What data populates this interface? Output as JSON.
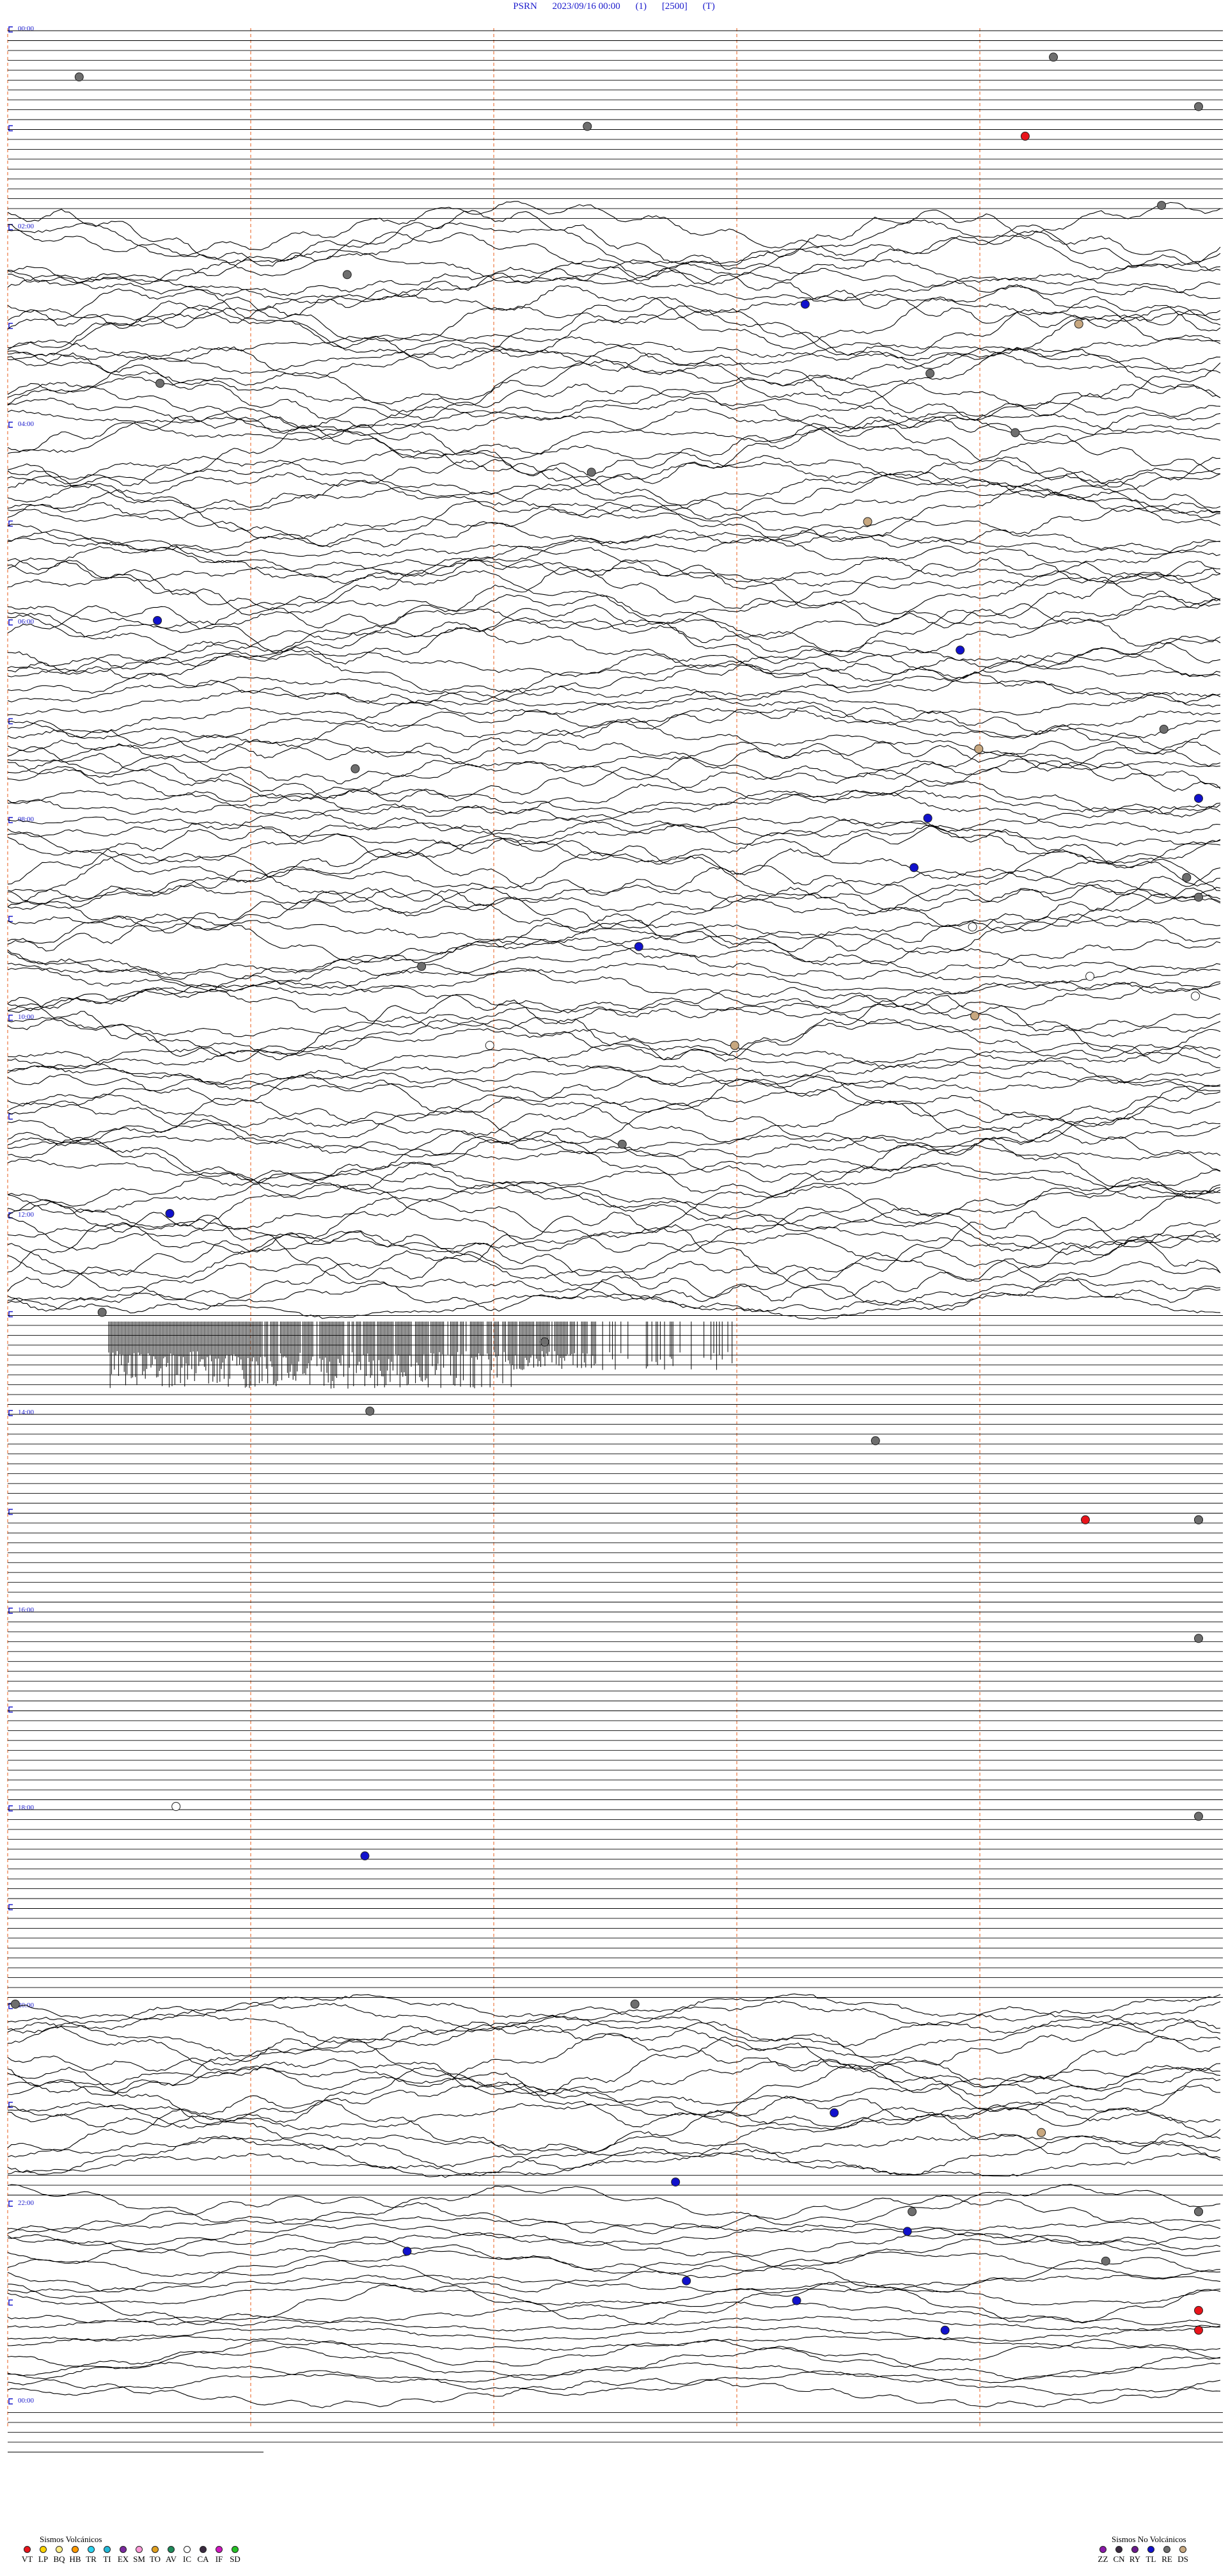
{
  "header": {
    "station": "PSRN",
    "datetime": "2023/09/16 00:00",
    "channel": "(1)",
    "scale": "[2500]",
    "unit": "(T)"
  },
  "chart_data": {
    "type": "line",
    "title": "PSRN 2023/09/16 00:00 (1) [2500] (T)",
    "time_labels": [
      "00:00",
      "02:00",
      "04:00",
      "06:00",
      "08:00",
      "10:00",
      "12:00",
      "14:00",
      "16:00",
      "18:00",
      "20:00",
      "22:00",
      "00:00"
    ],
    "rows_per_hour": 10,
    "minutes_per_row": 6,
    "vertical_marker_minutes": [
      0,
      1.2,
      2.4,
      3.6,
      4.8
    ],
    "active_periods": [
      {
        "from": "02:00",
        "to": "13:00",
        "amplitude": "high"
      },
      {
        "from": "20:00",
        "to": "21:40",
        "amplitude": "high"
      },
      {
        "from": "22:00",
        "to": "24:00",
        "amplitude": "medium"
      }
    ],
    "burst": {
      "row_hour": "13:00",
      "description": "dense spike train"
    },
    "events": [
      {
        "time": "00:22",
        "code": "RE"
      },
      {
        "time": "00:52",
        "code": "RE"
      },
      {
        "time": "00:30",
        "code": "RE"
      },
      {
        "time": "01:02",
        "code": "RE"
      },
      {
        "time": "01:06",
        "code": "VT"
      },
      {
        "time": "01:50",
        "code": "RE"
      },
      {
        "time": "02:30",
        "code": "RE"
      },
      {
        "time": "02:50",
        "code": "TL"
      },
      {
        "time": "03:00",
        "code": "DS"
      },
      {
        "time": "03:34",
        "code": "RE"
      },
      {
        "time": "03:36",
        "code": "RE"
      },
      {
        "time": "04:10",
        "code": "RE"
      },
      {
        "time": "04:30",
        "code": "RE"
      },
      {
        "time": "05:00",
        "code": "DS"
      },
      {
        "time": "06:00",
        "code": "TL"
      },
      {
        "time": "06:20",
        "code": "TL"
      },
      {
        "time": "07:10",
        "code": "RE"
      },
      {
        "time": "07:20",
        "code": "DS"
      },
      {
        "time": "07:50",
        "code": "TL"
      },
      {
        "time": "07:30",
        "code": "RE"
      },
      {
        "time": "08:00",
        "code": "TL"
      },
      {
        "time": "08:30",
        "code": "TL"
      },
      {
        "time": "08:40",
        "code": "RE"
      },
      {
        "time": "08:50",
        "code": "RE"
      },
      {
        "time": "09:10",
        "code": "IC"
      },
      {
        "time": "09:20",
        "code": "TL"
      },
      {
        "time": "09:30",
        "code": "RE"
      },
      {
        "time": "09:40",
        "code": "IC"
      },
      {
        "time": "09:50",
        "code": "IC"
      },
      {
        "time": "10:00",
        "code": "DS"
      },
      {
        "time": "10:20",
        "code": "IC"
      },
      {
        "time": "10:20",
        "code": "DS"
      },
      {
        "time": "11:20",
        "code": "RE"
      },
      {
        "time": "12:00",
        "code": "TL"
      },
      {
        "time": "13:00",
        "code": "RE"
      },
      {
        "time": "13:20",
        "code": "RE"
      },
      {
        "time": "14:00",
        "code": "RE"
      },
      {
        "time": "14:20",
        "code": "RE"
      },
      {
        "time": "15:10",
        "code": "VT"
      },
      {
        "time": "15:10",
        "code": "RE"
      },
      {
        "time": "15:10",
        "code": "RE"
      },
      {
        "time": "16:20",
        "code": "RE"
      },
      {
        "time": "18:00",
        "code": "IC"
      },
      {
        "time": "18:10",
        "code": "RE"
      },
      {
        "time": "18:30",
        "code": "TL"
      },
      {
        "time": "20:00",
        "code": "RE"
      },
      {
        "time": "20:00",
        "code": "RE"
      },
      {
        "time": "21:10",
        "code": "TL"
      },
      {
        "time": "21:20",
        "code": "DS"
      },
      {
        "time": "21:50",
        "code": "TL"
      },
      {
        "time": "22:10",
        "code": "RE"
      },
      {
        "time": "22:10",
        "code": "RE"
      },
      {
        "time": "22:10",
        "code": "RE"
      },
      {
        "time": "22:20",
        "code": "TL"
      },
      {
        "time": "22:30",
        "code": "TL"
      },
      {
        "time": "22:40",
        "code": "RE"
      },
      {
        "time": "22:50",
        "code": "TL"
      },
      {
        "time": "23:00",
        "code": "TL"
      },
      {
        "time": "23:10",
        "code": "VT"
      },
      {
        "time": "23:20",
        "code": "TL"
      },
      {
        "time": "23:20",
        "code": "VT"
      }
    ]
  },
  "legend": {
    "volcanic_title": "Sismos Volcánicos",
    "volcanic": [
      {
        "code": "VT",
        "color": "#e8141b"
      },
      {
        "code": "LP",
        "color": "#ffd400"
      },
      {
        "code": "BQ",
        "color": "#ffee88"
      },
      {
        "code": "HB",
        "color": "#ff9900"
      },
      {
        "code": "TR",
        "color": "#2ad3f0"
      },
      {
        "code": "TI",
        "color": "#22b8d8"
      },
      {
        "code": "EX",
        "color": "#7a2a9e"
      },
      {
        "code": "SM",
        "color": "#ff9ad8"
      },
      {
        "code": "TO",
        "color": "#e0a020"
      },
      {
        "code": "AV",
        "color": "#1d8a5a"
      },
      {
        "code": "IC",
        "color": "#ffffff"
      },
      {
        "code": "CA",
        "color": "#3a2a40"
      },
      {
        "code": "IF",
        "color": "#d016c0"
      },
      {
        "code": "SD",
        "color": "#25c025"
      }
    ],
    "nonvolcanic_title": "Sismos No Volcánicos",
    "nonvolcanic": [
      {
        "code": "ZZ",
        "color": "#8a1aa8"
      },
      {
        "code": "CN",
        "color": "#3a2a40"
      },
      {
        "code": "RY",
        "color": "#6a1a8a"
      },
      {
        "code": "TL",
        "color": "#1111cc"
      },
      {
        "code": "RE",
        "color": "#6e6e6e"
      },
      {
        "code": "DS",
        "color": "#c8a880"
      }
    ]
  }
}
